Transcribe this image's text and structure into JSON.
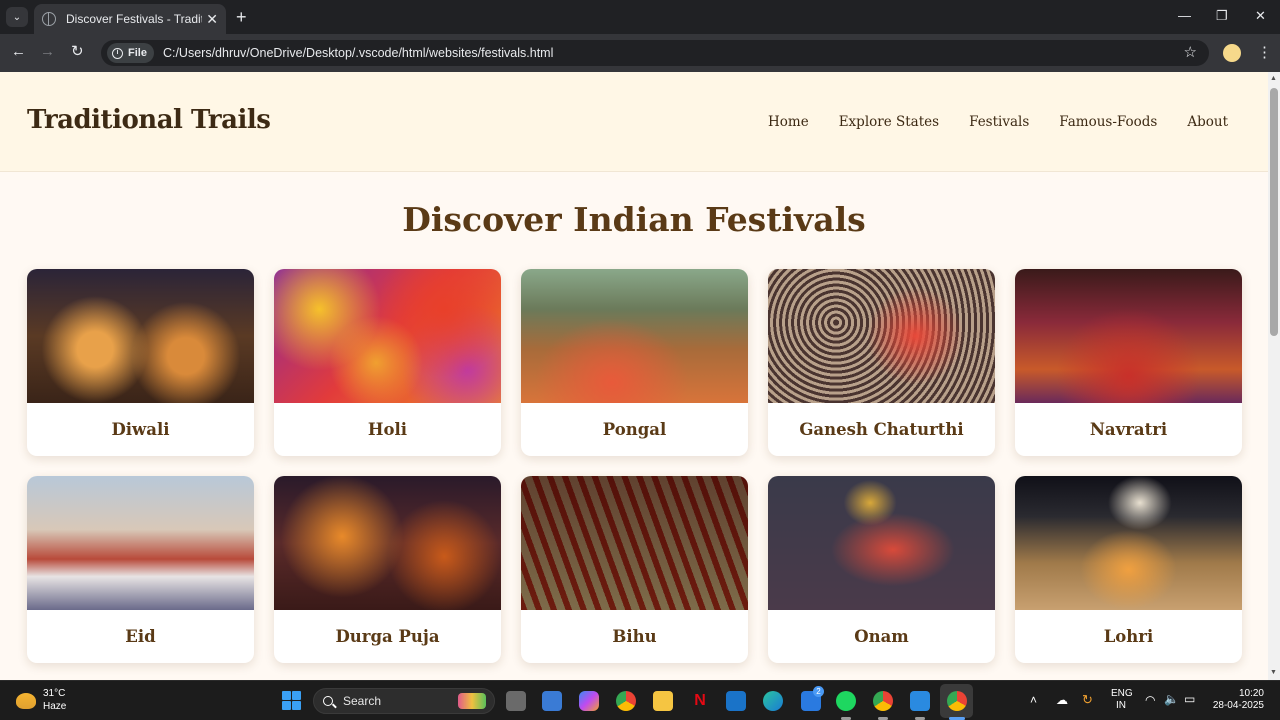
{
  "browser": {
    "tab_title": "Discover Festivals - Traditional Trails",
    "new_tab": "+",
    "close_tab": "✕",
    "chip_label": "File",
    "url": "C:/Users/dhruv/OneDrive/Desktop/.vscode/html/websites/festivals.html",
    "back": "←",
    "forward": "→",
    "reload": "↻",
    "star": "☆",
    "menu": "⋮",
    "tab_menu": "⌄",
    "minimize": "—",
    "maximize": "❐",
    "close_window": "✕"
  },
  "site": {
    "brand": "Traditional Trails",
    "nav": [
      "Home",
      "Explore States",
      "Festivals",
      "Famous-Foods",
      "About"
    ],
    "page_title": "Discover Indian Festivals",
    "festivals": [
      {
        "name": "Diwali"
      },
      {
        "name": "Holi"
      },
      {
        "name": "Pongal"
      },
      {
        "name": "Ganesh Chaturthi"
      },
      {
        "name": "Navratri"
      },
      {
        "name": "Eid"
      },
      {
        "name": "Durga Puja"
      },
      {
        "name": "Bihu"
      },
      {
        "name": "Onam"
      },
      {
        "name": "Lohri"
      }
    ]
  },
  "taskbar": {
    "temperature": "31°C",
    "condition": "Haze",
    "search_text": "Search",
    "lang_top": "ENG",
    "lang_bottom": "IN",
    "time": "10:20",
    "date": "28-04-2025",
    "notification_count": "2"
  },
  "colors": {
    "header_bg": "#fff7e6",
    "page_bg": "#fff9f3",
    "title_brown": "#5a3a16",
    "brand_dark": "#3d2a14"
  }
}
